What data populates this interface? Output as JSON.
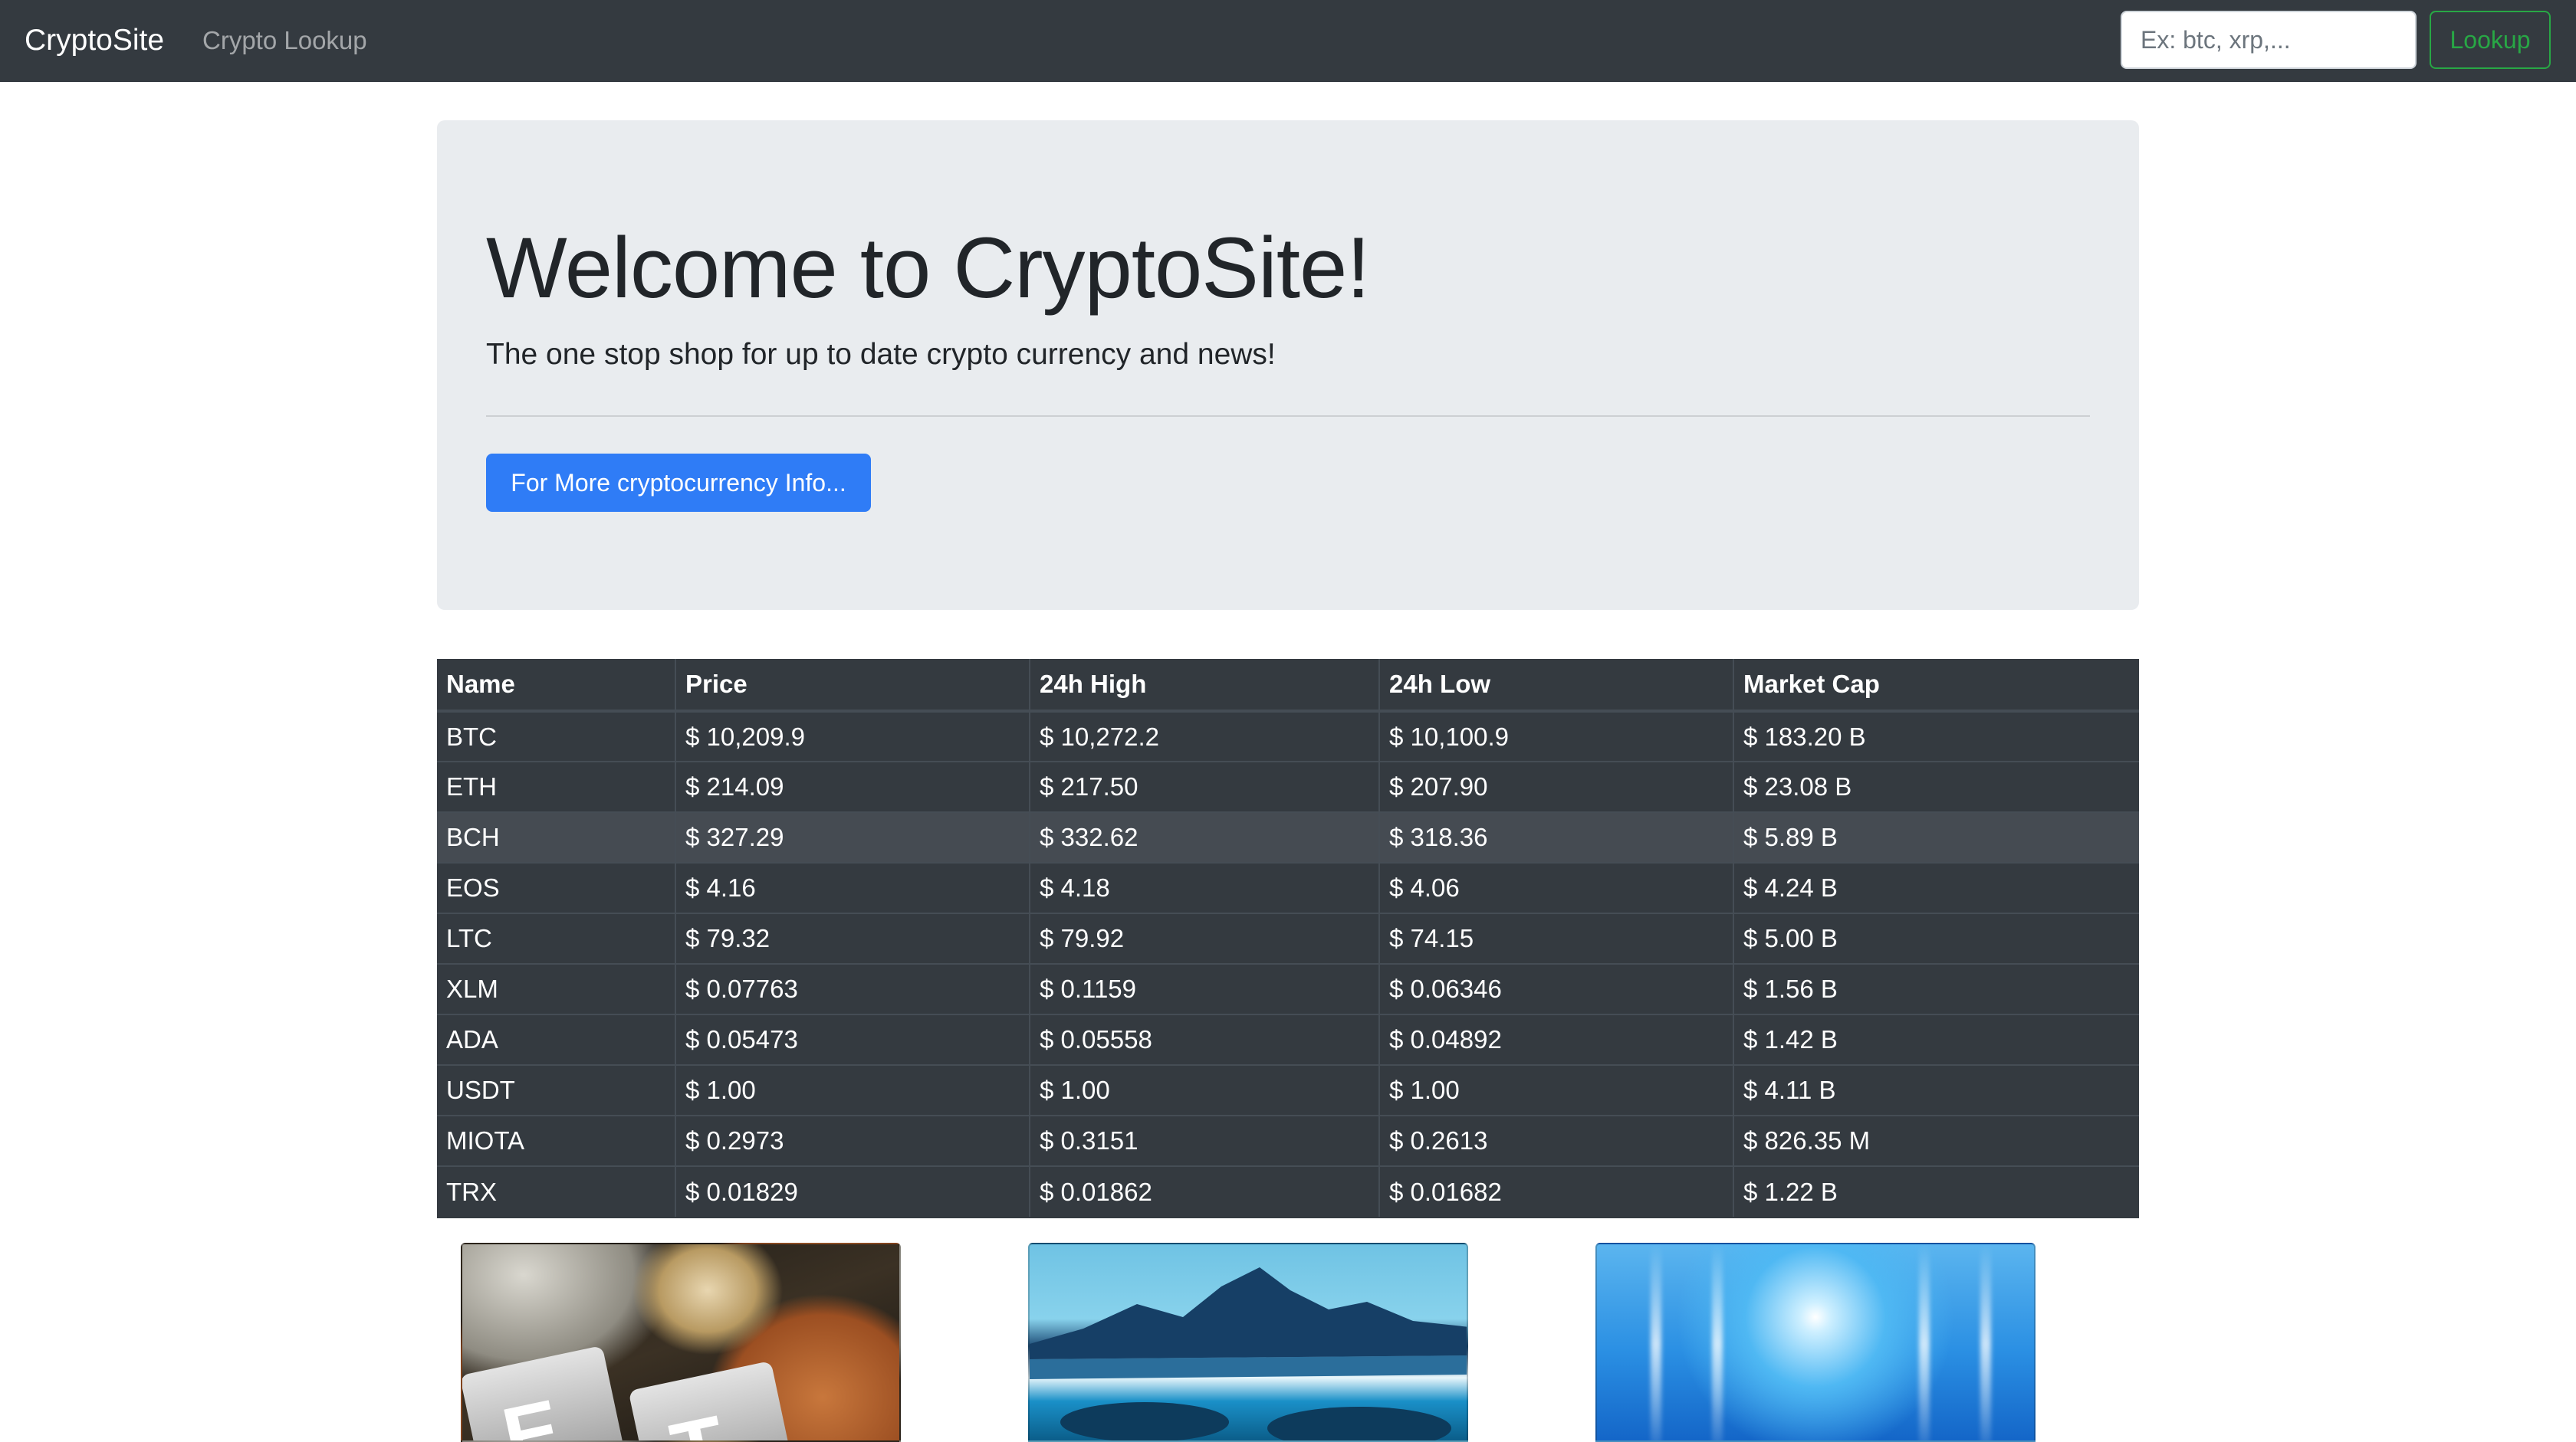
{
  "navbar": {
    "brand": "CryptoSite",
    "nav_link": "Crypto Lookup",
    "search_placeholder": "Ex: btc, xrp,...",
    "lookup_label": "Lookup"
  },
  "jumbotron": {
    "title": "Welcome to CryptoSite!",
    "lead": "The one stop shop for up to date crypto currency and news!",
    "button_label": "For More cryptocurrency Info..."
  },
  "table": {
    "headers": [
      "Name",
      "Price",
      "24h High",
      "24h Low",
      "Market Cap"
    ],
    "rows": [
      [
        "BTC",
        "$ 10,209.9",
        "$ 10,272.2",
        "$ 10,100.9",
        "$ 183.20 B"
      ],
      [
        "ETH",
        "$ 214.09",
        "$ 217.50",
        "$ 207.90",
        "$ 23.08 B"
      ],
      [
        "BCH",
        "$ 327.29",
        "$ 332.62",
        "$ 318.36",
        "$ 5.89 B"
      ],
      [
        "EOS",
        "$ 4.16",
        "$ 4.18",
        "$ 4.06",
        "$ 4.24 B"
      ],
      [
        "LTC",
        "$ 79.32",
        "$ 79.92",
        "$ 74.15",
        "$ 5.00 B"
      ],
      [
        "XLM",
        "$ 0.07763",
        "$ 0.1159",
        "$ 0.06346",
        "$ 1.56 B"
      ],
      [
        "ADA",
        "$ 0.05473",
        "$ 0.05558",
        "$ 0.04892",
        "$ 1.42 B"
      ],
      [
        "USDT",
        "$ 1.00",
        "$ 1.00",
        "$ 1.00",
        "$ 4.11 B"
      ],
      [
        "MIOTA",
        "$ 0.2973",
        "$ 0.3151",
        "$ 0.2613",
        "$ 826.35 M"
      ],
      [
        "TRX",
        "$ 0.01829",
        "$ 0.01862",
        "$ 0.01682",
        "$ 1.22 B"
      ]
    ]
  },
  "colors": {
    "navbar_bg": "#343a40",
    "jumbotron_bg": "#e9ecef",
    "primary": "#2f7cf6",
    "success": "#28a745",
    "table_bg": "#343a40"
  }
}
